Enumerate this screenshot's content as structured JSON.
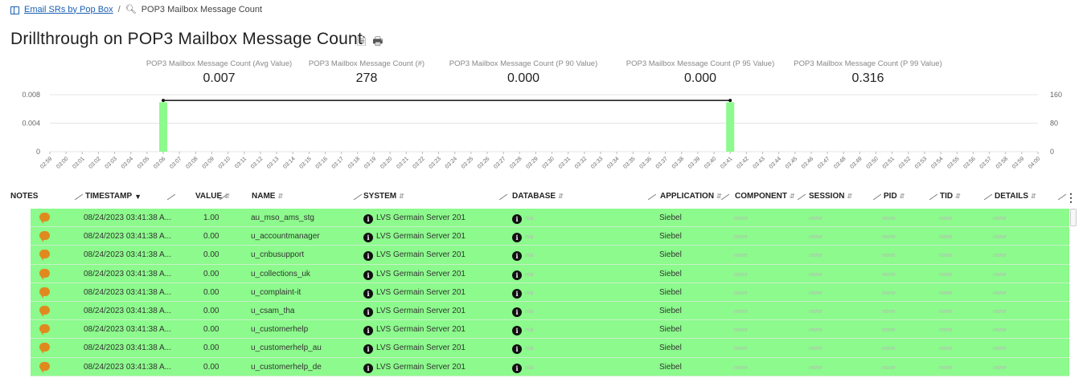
{
  "breadcrumb": {
    "link": "Email SRs by Pop Box",
    "separator": "/",
    "current": "POP3 Mailbox Message Count"
  },
  "page_title": "Drillthrough on POP3 Mailbox Message Count",
  "title_icons": [
    "export-icon",
    "print-icon"
  ],
  "stats": [
    {
      "label": "POP3 Mailbox Message Count (Avg Value)",
      "value": "0.007"
    },
    {
      "label": "POP3 Mailbox Message Count (#)",
      "value": "278"
    },
    {
      "label": "POP3 Mailbox Message Count (P 90 Value)",
      "value": "0.000"
    },
    {
      "label": "POP3 Mailbox Message Count (P 95 Value)",
      "value": "0.000"
    },
    {
      "label": "POP3 Mailbox Message Count (P 99 Value)",
      "value": "0.316"
    }
  ],
  "chart_data": {
    "type": "bar",
    "categories": [
      "02:59",
      "03:00",
      "03:01",
      "03:02",
      "03:03",
      "03:04",
      "03:05",
      "03:06",
      "03:07",
      "03:08",
      "03:09",
      "03:10",
      "03:11",
      "03:12",
      "03:13",
      "03:14",
      "03:15",
      "03:16",
      "03:17",
      "03:18",
      "03:19",
      "03:20",
      "03:21",
      "03:22",
      "03:23",
      "03:24",
      "03:25",
      "03:26",
      "03:27",
      "03:28",
      "03:29",
      "03:30",
      "03:31",
      "03:32",
      "03:33",
      "03:34",
      "03:35",
      "03:36",
      "03:37",
      "03:38",
      "03:39",
      "03:40",
      "03:41",
      "03:42",
      "03:43",
      "03:44",
      "03:45",
      "03:46",
      "03:47",
      "03:48",
      "03:49",
      "03:50",
      "03:51",
      "03:52",
      "03:53",
      "03:54",
      "03:55",
      "03:56",
      "03:57",
      "03:58",
      "03:59",
      "04:00"
    ],
    "series": [
      {
        "type": "bar",
        "axis": "right",
        "values": {
          "03:06": 139,
          "03:41": 139
        },
        "color": "#8cfa8c"
      },
      {
        "type": "line",
        "axis": "left",
        "points": [
          [
            "03:06",
            0.0072
          ],
          [
            "03:41",
            0.0072
          ]
        ],
        "color": "#111111"
      }
    ],
    "y_left": {
      "ticks": [
        "0",
        "0.004",
        "0.008"
      ],
      "range": [
        0,
        0.008
      ]
    },
    "y_right": {
      "ticks": [
        "0",
        "80",
        "160"
      ],
      "range": [
        0,
        160
      ]
    },
    "grid": true
  },
  "table": {
    "columns": [
      "NOTES",
      "TIMESTAMP",
      "VALUE",
      "NAME",
      "SYSTEM",
      "DATABASE",
      "APPLICATION",
      "COMPONENT",
      "SESSION",
      "PID",
      "TID",
      "DETAILS"
    ],
    "rows": [
      {
        "timestamp": "08/24/2023 03:41:38 A...",
        "value": "1.00",
        "name": "au_mso_ams_stg",
        "system": "LVS Germain Server 201",
        "database": "n/a",
        "application": "Siebel",
        "component": "none",
        "session": "none",
        "pid": "none",
        "tid": "none",
        "details": "none"
      },
      {
        "timestamp": "08/24/2023 03:41:38 A...",
        "value": "0.00",
        "name": "u_accountmanager",
        "system": "LVS Germain Server 201",
        "database": "n/a",
        "application": "Siebel",
        "component": "none",
        "session": "none",
        "pid": "none",
        "tid": "none",
        "details": "none"
      },
      {
        "timestamp": "08/24/2023 03:41:38 A...",
        "value": "0.00",
        "name": "u_cnbusupport",
        "system": "LVS Germain Server 201",
        "database": "n/a",
        "application": "Siebel",
        "component": "none",
        "session": "none",
        "pid": "none",
        "tid": "none",
        "details": "none"
      },
      {
        "timestamp": "08/24/2023 03:41:38 A...",
        "value": "0.00",
        "name": "u_collections_uk",
        "system": "LVS Germain Server 201",
        "database": "n/a",
        "application": "Siebel",
        "component": "none",
        "session": "none",
        "pid": "none",
        "tid": "none",
        "details": "none"
      },
      {
        "timestamp": "08/24/2023 03:41:38 A...",
        "value": "0.00",
        "name": "u_complaint-it",
        "system": "LVS Germain Server 201",
        "database": "n/a",
        "application": "Siebel",
        "component": "none",
        "session": "none",
        "pid": "none",
        "tid": "none",
        "details": "none"
      },
      {
        "timestamp": "08/24/2023 03:41:38 A...",
        "value": "0.00",
        "name": "u_csam_tha",
        "system": "LVS Germain Server 201",
        "database": "n/a",
        "application": "Siebel",
        "component": "none",
        "session": "none",
        "pid": "none",
        "tid": "none",
        "details": "none"
      },
      {
        "timestamp": "08/24/2023 03:41:38 A...",
        "value": "0.00",
        "name": "u_customerhelp",
        "system": "LVS Germain Server 201",
        "database": "n/a",
        "application": "Siebel",
        "component": "none",
        "session": "none",
        "pid": "none",
        "tid": "none",
        "details": "none"
      },
      {
        "timestamp": "08/24/2023 03:41:38 A...",
        "value": "0.00",
        "name": "u_customerhelp_au",
        "system": "LVS Germain Server 201",
        "database": "n/a",
        "application": "Siebel",
        "component": "none",
        "session": "none",
        "pid": "none",
        "tid": "none",
        "details": "none"
      },
      {
        "timestamp": "08/24/2023 03:41:38 A...",
        "value": "0.00",
        "name": "u_customerhelp_de",
        "system": "LVS Germain Server 201",
        "database": "n/a",
        "application": "Siebel",
        "component": "none",
        "session": "none",
        "pid": "none",
        "tid": "none",
        "details": "none"
      }
    ]
  },
  "colors": {
    "row_bg": "#8cfa8c",
    "link": "#1a5fb4",
    "note_icon": "#e08a1e"
  }
}
